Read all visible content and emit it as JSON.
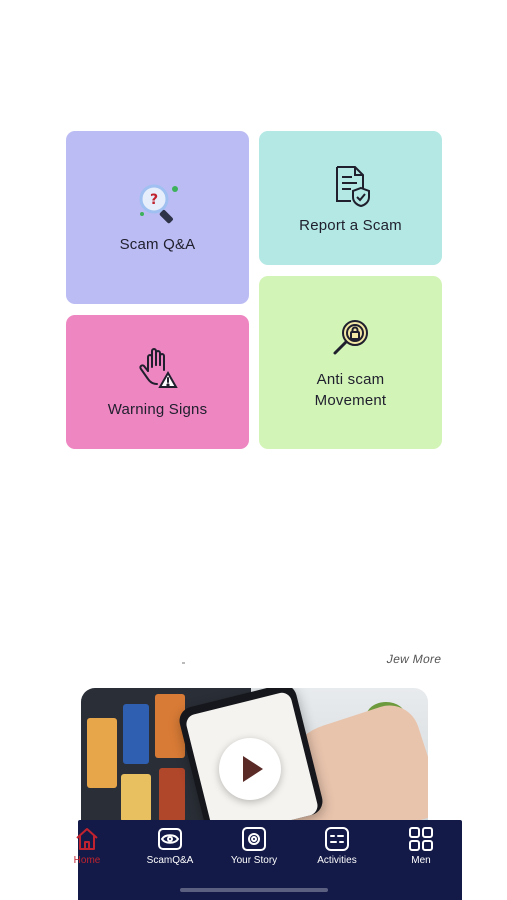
{
  "colors": {
    "purple": "#bcbcf4",
    "teal": "#b3e8e4",
    "pink": "#ee86c1",
    "green": "#d3f4b7",
    "navy": "#131a47",
    "active": "#c0232f"
  },
  "tiles": {
    "scam_qa": {
      "label": "Scam Q&A",
      "icon": "magnifier-question-icon"
    },
    "report": {
      "label": "Report a Scam",
      "icon": "document-shield-icon"
    },
    "warning": {
      "label": "Warning Signs",
      "icon": "hand-warning-icon"
    },
    "movement": {
      "label": "Anti scam Movement",
      "icon": "magnifier-lock-icon"
    }
  },
  "video": {
    "view_more": "Jew More",
    "icon": "play-icon"
  },
  "tabbar": {
    "items": [
      {
        "label": "Home",
        "icon": "home-icon",
        "active": true
      },
      {
        "label": "ScamQ&A",
        "icon": "eye-icon",
        "active": false
      },
      {
        "label": "Your Story",
        "icon": "story-icon",
        "active": false
      },
      {
        "label": "Activities",
        "icon": "activities-icon",
        "active": false
      },
      {
        "label": "Men",
        "icon": "grid-icon",
        "active": false
      }
    ]
  }
}
